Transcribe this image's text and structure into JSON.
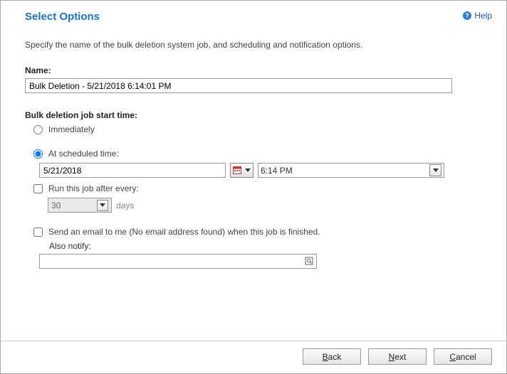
{
  "header": {
    "title": "Select Options",
    "help": "Help"
  },
  "desc": "Specify the name of the bulk deletion system job, and scheduling and notification options.",
  "name": {
    "label": "Name:",
    "value": "Bulk Deletion - 5/21/2018 6:14:01 PM"
  },
  "schedule": {
    "section_label": "Bulk deletion job start time:",
    "immediately": "Immediately",
    "at_scheduled": "At scheduled time:",
    "date_value": "5/21/2018",
    "time_value": "6:14 PM",
    "run_after_label": "Run this job after every:",
    "run_after_value": "30",
    "run_after_unit": "days"
  },
  "notify": {
    "email_label": "Send an email to me (No email address found) when this job is finished.",
    "also_label": "Also notify:",
    "notify_value": ""
  },
  "buttons": {
    "back": "Back",
    "next": "Next",
    "cancel": "Cancel"
  }
}
